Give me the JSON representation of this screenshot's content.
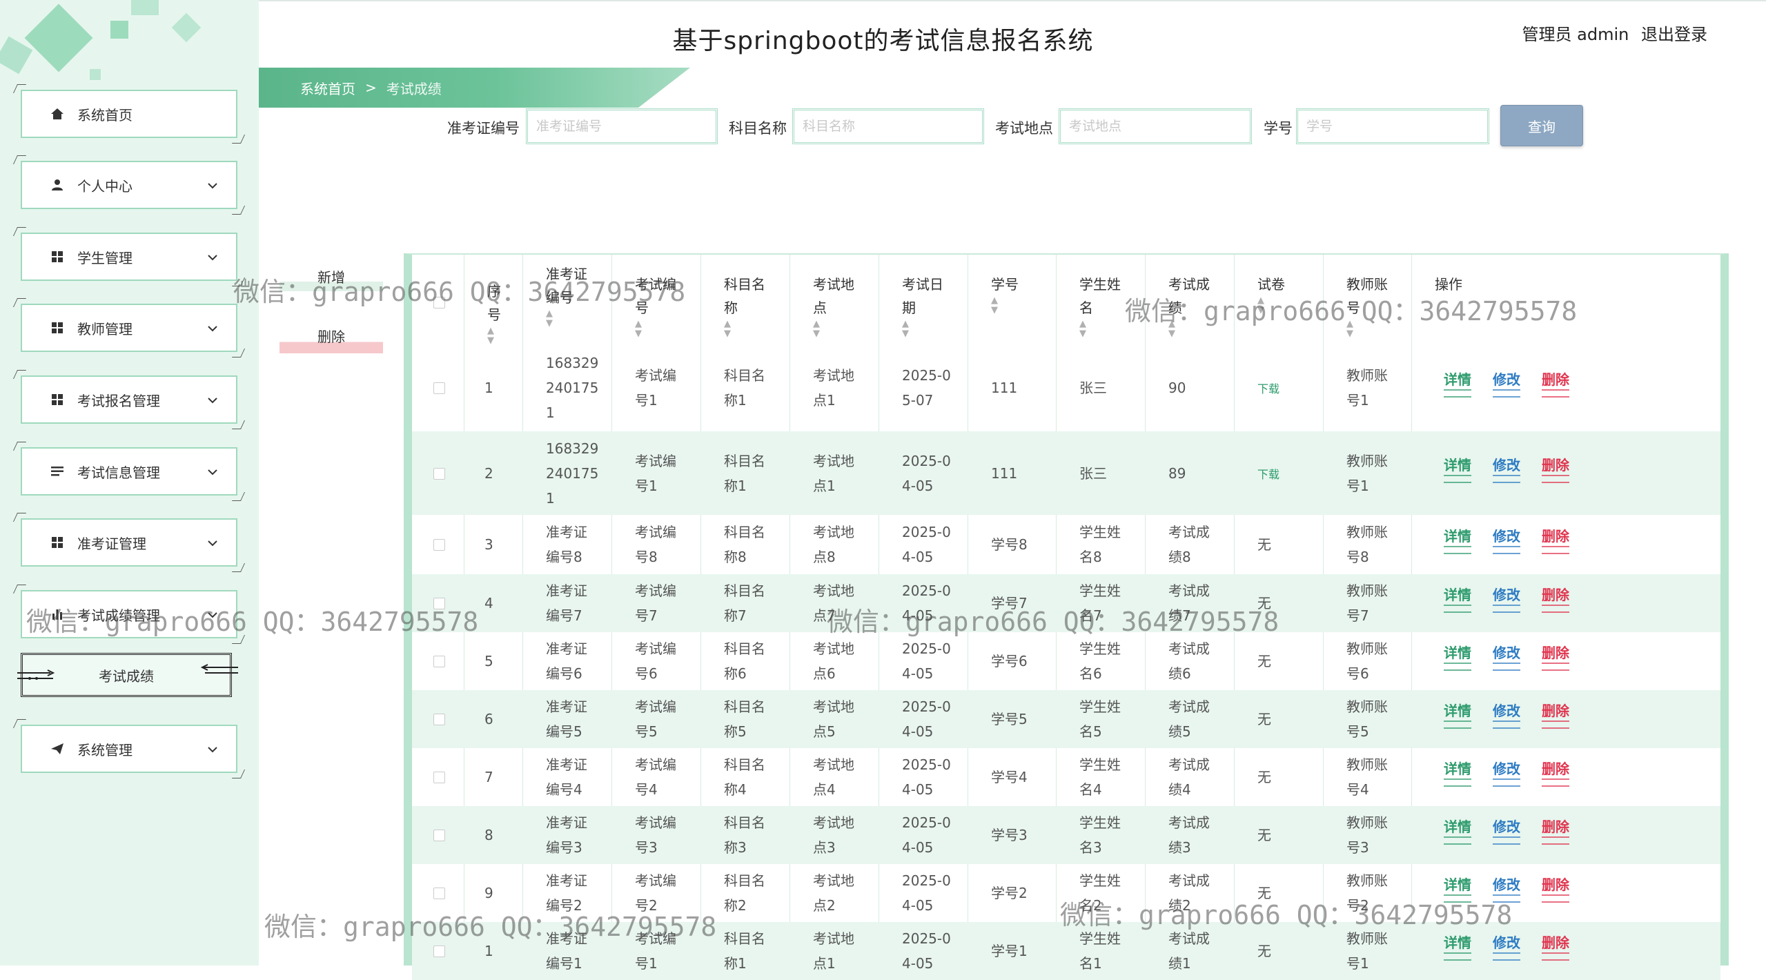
{
  "app": {
    "title": "基于springboot的考试信息报名系统"
  },
  "user": {
    "role_label": "管理员 admin",
    "logout_label": "退出登录"
  },
  "breadcrumb": {
    "home": "系统首页",
    "sep": ">",
    "current": "考试成绩"
  },
  "sidebar": {
    "items": [
      {
        "label": "系统首页",
        "icon": "home-icon"
      },
      {
        "label": "个人中心",
        "icon": "user-icon"
      },
      {
        "label": "学生管理",
        "icon": "grid-icon"
      },
      {
        "label": "教师管理",
        "icon": "grid-icon"
      },
      {
        "label": "考试报名管理",
        "icon": "grid-icon"
      },
      {
        "label": "考试信息管理",
        "icon": "list-icon"
      },
      {
        "label": "准考证管理",
        "icon": "grid-icon"
      },
      {
        "label": "考试成绩管理",
        "icon": "bar-chart-icon"
      },
      {
        "label": "系统管理",
        "icon": "send-icon"
      }
    ],
    "sub_item": "考试成绩"
  },
  "search": {
    "fields": [
      {
        "label": "准考证编号",
        "placeholder": "准考证编号"
      },
      {
        "label": "科目名称",
        "placeholder": "科目名称"
      },
      {
        "label": "考试地点",
        "placeholder": "考试地点"
      },
      {
        "label": "学号",
        "placeholder": "学号"
      }
    ],
    "button": "查询"
  },
  "actions": {
    "add": "新增",
    "delete": "删除"
  },
  "table": {
    "headers": [
      [
        "序",
        "号"
      ],
      [
        "准考证",
        "编号"
      ],
      [
        "考试编",
        "号"
      ],
      [
        "科目名",
        "称"
      ],
      [
        "考试地",
        "点"
      ],
      [
        "考试日",
        "期"
      ],
      [
        "学号"
      ],
      [
        "学生姓",
        "名"
      ],
      [
        "考试成",
        "绩"
      ],
      [
        "试卷"
      ],
      [
        "教师账",
        "号"
      ],
      [
        "操作"
      ]
    ],
    "rows": [
      {
        "no": "1",
        "ticket": [
          "168329",
          "240175",
          "1"
        ],
        "exam": [
          "考试编",
          "号1"
        ],
        "subject": [
          "科目名",
          "称1"
        ],
        "place": [
          "考试地",
          "点1"
        ],
        "date": [
          "2025-0",
          "5-07"
        ],
        "sid": "111",
        "name": [
          "张三"
        ],
        "score": [
          "90"
        ],
        "paper": "下载",
        "teacher": [
          "教师账",
          "号1"
        ]
      },
      {
        "no": "2",
        "ticket": [
          "168329",
          "240175",
          "1"
        ],
        "exam": [
          "考试编",
          "号1"
        ],
        "subject": [
          "科目名",
          "称1"
        ],
        "place": [
          "考试地",
          "点1"
        ],
        "date": [
          "2025-0",
          "4-05"
        ],
        "sid": "111",
        "name": [
          "张三"
        ],
        "score": [
          "89"
        ],
        "paper": "下载",
        "teacher": [
          "教师账",
          "号1"
        ]
      },
      {
        "no": "3",
        "ticket": [
          "准考证",
          "编号8"
        ],
        "exam": [
          "考试编",
          "号8"
        ],
        "subject": [
          "科目名",
          "称8"
        ],
        "place": [
          "考试地",
          "点8"
        ],
        "date": [
          "2025-0",
          "4-05"
        ],
        "sid": "学号8",
        "name": [
          "学生姓",
          "名8"
        ],
        "score": [
          "考试成",
          "绩8"
        ],
        "paper": "无",
        "teacher": [
          "教师账",
          "号8"
        ]
      },
      {
        "no": "4",
        "ticket": [
          "准考证",
          "编号7"
        ],
        "exam": [
          "考试编",
          "号7"
        ],
        "subject": [
          "科目名",
          "称7"
        ],
        "place": [
          "考试地",
          "点7"
        ],
        "date": [
          "2025-0",
          "4-05"
        ],
        "sid": "学号7",
        "name": [
          "学生姓",
          "名7"
        ],
        "score": [
          "考试成",
          "绩7"
        ],
        "paper": "无",
        "teacher": [
          "教师账",
          "号7"
        ]
      },
      {
        "no": "5",
        "ticket": [
          "准考证",
          "编号6"
        ],
        "exam": [
          "考试编",
          "号6"
        ],
        "subject": [
          "科目名",
          "称6"
        ],
        "place": [
          "考试地",
          "点6"
        ],
        "date": [
          "2025-0",
          "4-05"
        ],
        "sid": "学号6",
        "name": [
          "学生姓",
          "名6"
        ],
        "score": [
          "考试成",
          "绩6"
        ],
        "paper": "无",
        "teacher": [
          "教师账",
          "号6"
        ]
      },
      {
        "no": "6",
        "ticket": [
          "准考证",
          "编号5"
        ],
        "exam": [
          "考试编",
          "号5"
        ],
        "subject": [
          "科目名",
          "称5"
        ],
        "place": [
          "考试地",
          "点5"
        ],
        "date": [
          "2025-0",
          "4-05"
        ],
        "sid": "学号5",
        "name": [
          "学生姓",
          "名5"
        ],
        "score": [
          "考试成",
          "绩5"
        ],
        "paper": "无",
        "teacher": [
          "教师账",
          "号5"
        ]
      },
      {
        "no": "7",
        "ticket": [
          "准考证",
          "编号4"
        ],
        "exam": [
          "考试编",
          "号4"
        ],
        "subject": [
          "科目名",
          "称4"
        ],
        "place": [
          "考试地",
          "点4"
        ],
        "date": [
          "2025-0",
          "4-05"
        ],
        "sid": "学号4",
        "name": [
          "学生姓",
          "名4"
        ],
        "score": [
          "考试成",
          "绩4"
        ],
        "paper": "无",
        "teacher": [
          "教师账",
          "号4"
        ]
      },
      {
        "no": "8",
        "ticket": [
          "准考证",
          "编号3"
        ],
        "exam": [
          "考试编",
          "号3"
        ],
        "subject": [
          "科目名",
          "称3"
        ],
        "place": [
          "考试地",
          "点3"
        ],
        "date": [
          "2025-0",
          "4-05"
        ],
        "sid": "学号3",
        "name": [
          "学生姓",
          "名3"
        ],
        "score": [
          "考试成",
          "绩3"
        ],
        "paper": "无",
        "teacher": [
          "教师账",
          "号3"
        ]
      },
      {
        "no": "9",
        "ticket": [
          "准考证",
          "编号2"
        ],
        "exam": [
          "考试编",
          "号2"
        ],
        "subject": [
          "科目名",
          "称2"
        ],
        "place": [
          "考试地",
          "点2"
        ],
        "date": [
          "2025-0",
          "4-05"
        ],
        "sid": "学号2",
        "name": [
          "学生姓",
          "名2"
        ],
        "score": [
          "考试成",
          "绩2"
        ],
        "paper": "无",
        "teacher": [
          "教师账",
          "号2"
        ]
      },
      {
        "no": "1",
        "ticket": [
          "准考证",
          "编号1"
        ],
        "exam": [
          "考试编",
          "号1"
        ],
        "subject": [
          "科目名",
          "称1"
        ],
        "place": [
          "考试地",
          "点1"
        ],
        "date": [
          "2025-0",
          "4-05"
        ],
        "sid": "学号1",
        "name": [
          "学生姓",
          "名1"
        ],
        "score": [
          "考试成",
          "绩1"
        ],
        "paper": "无",
        "teacher": [
          "教师账",
          "号1"
        ]
      }
    ],
    "row_actions": {
      "detail": "详情",
      "edit": "修改",
      "delete": "删除"
    }
  },
  "watermark": "微信：grapro666 QQ：3642795578",
  "colors": {
    "sidebar_bg": "#e6f6ee",
    "accent": "#5bb58a",
    "detail": "#2e9b6d",
    "edit": "#2f7cc3",
    "delete": "#e0354f"
  }
}
